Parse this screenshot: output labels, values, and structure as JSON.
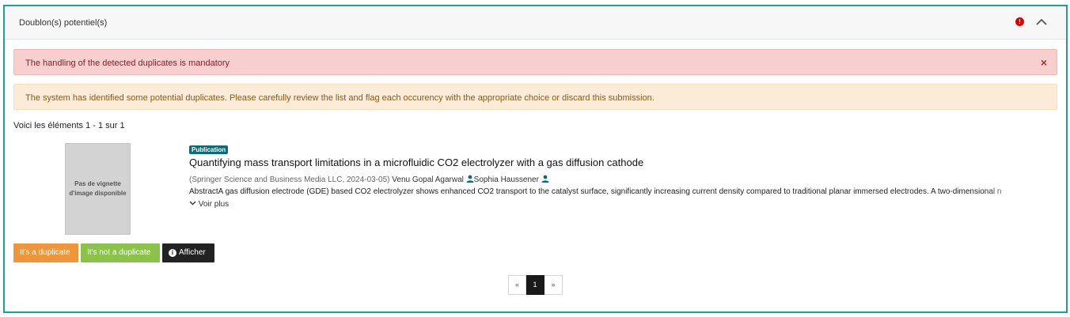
{
  "panel": {
    "title": "Doublon(s) potentiel(s)",
    "alert_indicator": "!",
    "collapse_icon": "chevron-up-icon"
  },
  "alerts": {
    "danger": "The handling of the detected duplicates is mandatory",
    "danger_close": "×",
    "warning": "The system has identified some potential duplicates. Please carefully review the list and flag each occurency with the appropriate choice or discard this submission."
  },
  "results": {
    "count_text": "Voici les éléments 1 - 1 sur 1"
  },
  "item": {
    "thumbnail_text": "Pas de vignette d'image disponible",
    "type_badge": "Publication",
    "title": "Quantifying mass transport limitations in a microfluidic CO2 electrolyzer with a gas diffusion cathode",
    "publisher_date": "(Springer Science and Business Media LLC, 2024-03-05)",
    "authors": [
      "Venu Gopal Agarwal",
      "Sophia Haussener"
    ],
    "abstract": "AbstractA gas diffusion electrode (GDE) based CO2 electrolyzer shows enhanced CO2 transport to the catalyst surface, significantly increasing current density compared to traditional planar immersed electrodes. A two-dimensional n",
    "voir_plus": "Voir plus"
  },
  "actions": {
    "duplicate": "It's a duplicate",
    "not_duplicate": "It's not a duplicate",
    "show": "Afficher",
    "show_icon": "info-icon"
  },
  "pagination": {
    "prev": "«",
    "current": "1",
    "next": "»"
  },
  "colors": {
    "panel_border": "#17a398",
    "danger_bg": "#f8cfcf",
    "warning_bg": "#fcebd6",
    "badge": "#0a6c74",
    "btn_duplicate": "#f0963a",
    "btn_not_duplicate": "#8bc34a",
    "btn_show": "#222222",
    "person_icon": "#0a6c74"
  }
}
